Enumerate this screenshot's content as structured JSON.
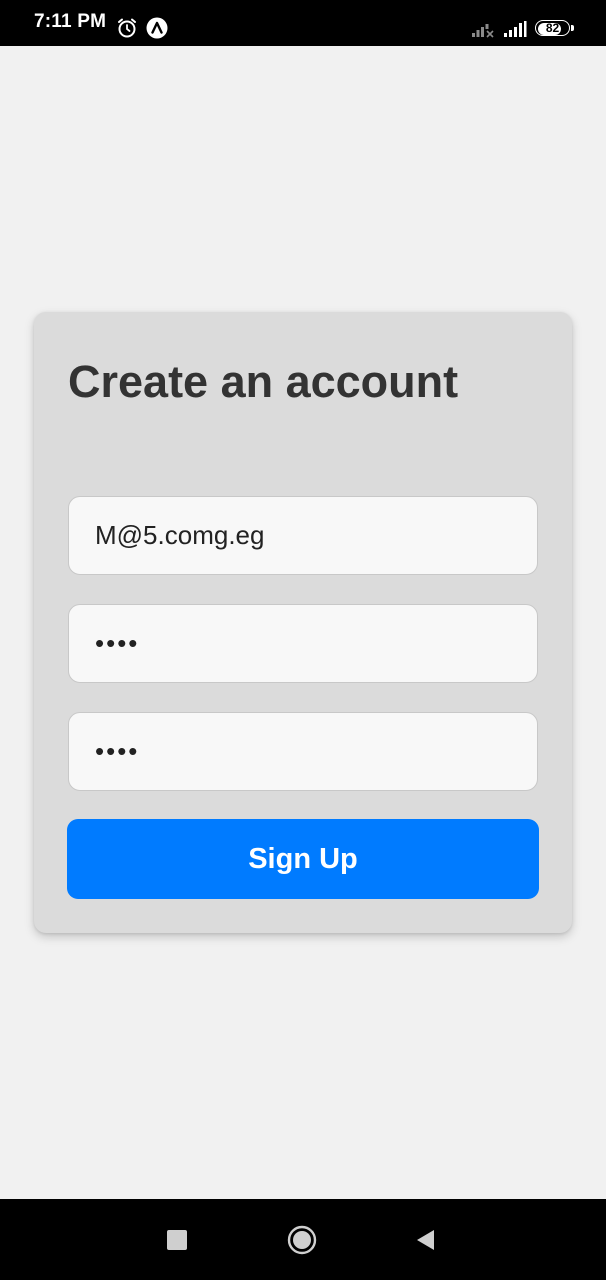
{
  "status_bar": {
    "time": "7:11 PM",
    "battery_percent": "82",
    "battery_level": 0.82,
    "icons": [
      "alarm-icon",
      "app-notification-icon",
      "signal-no-data-icon",
      "signal-icon",
      "battery-icon"
    ]
  },
  "form": {
    "title": "Create an account",
    "email_value": "M@5.comg.eg",
    "password_value": "1234",
    "confirm_password_value": "1234",
    "submit_label": "Sign Up"
  },
  "colors": {
    "background": "#f1f1f1",
    "card": "#dbdbdb",
    "accent": "#007bff",
    "title_text": "#333333"
  },
  "nav_bar": {
    "icons": [
      "recents-icon",
      "home-icon",
      "back-icon"
    ]
  }
}
